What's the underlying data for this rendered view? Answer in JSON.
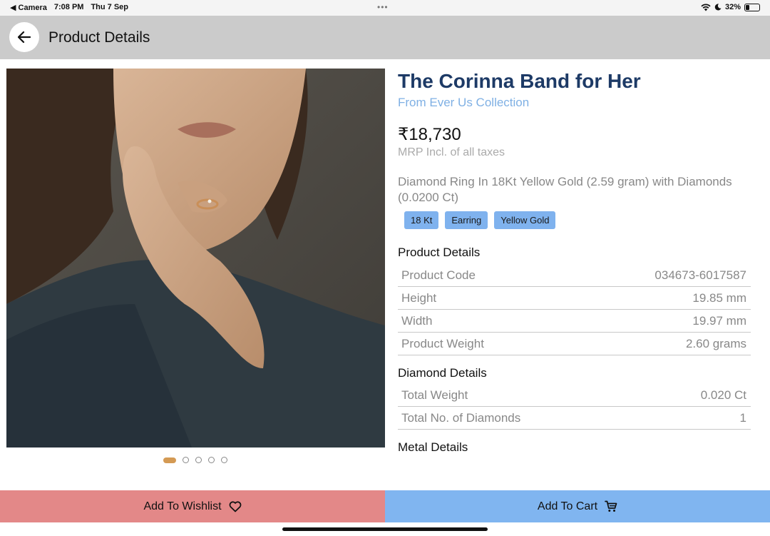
{
  "status_bar": {
    "back_app": "◀ Camera",
    "time": "7:08 PM",
    "date": "Thu 7 Sep",
    "battery": "32%",
    "battery_level": 0.32
  },
  "header": {
    "title": "Product Details",
    "back_icon": "arrow-left-icon"
  },
  "product": {
    "title": "The Corinna Band for Her",
    "collection": "From Ever Us Collection",
    "price": "₹18,730",
    "price_note": "MRP Incl. of all taxes",
    "description": "Diamond Ring In 18Kt Yellow Gold (2.59 gram) with Diamonds (0.0200 Ct)",
    "tags": [
      "18 Kt",
      "Earring",
      "Yellow Gold"
    ]
  },
  "carousel": {
    "total": 5,
    "active_index": 0
  },
  "product_details": {
    "heading": "Product Details",
    "rows": [
      {
        "label": "Product Code",
        "value": "034673-6017587"
      },
      {
        "label": "Height",
        "value": "19.85 mm"
      },
      {
        "label": "Width",
        "value": "19.97 mm"
      },
      {
        "label": "Product Weight",
        "value": "2.60 grams"
      }
    ]
  },
  "diamond_details": {
    "heading": "Diamond Details",
    "rows": [
      {
        "label": "Total Weight",
        "value": "0.020 Ct"
      },
      {
        "label": "Total No. of Diamonds",
        "value": "1"
      }
    ]
  },
  "metal_details": {
    "heading": "Metal Details"
  },
  "actions": {
    "wishlist_label": "Add To Wishlist",
    "wishlist_icon": "heart-icon",
    "cart_label": "Add To Cart",
    "cart_icon": "cart-icon"
  },
  "colors": {
    "title": "#1d3a66",
    "collection": "#7fb0e4",
    "tag": "#7fb2ee",
    "wishlist": "#e38888",
    "cart": "#80b5f0",
    "carousel_active": "#d49a54"
  }
}
